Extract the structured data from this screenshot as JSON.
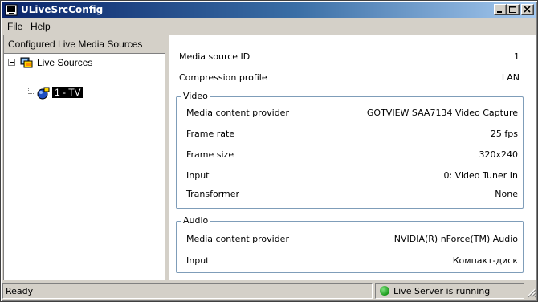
{
  "window": {
    "title": "ULiveSrcConfig"
  },
  "menu": {
    "items": [
      "File",
      "Help"
    ]
  },
  "left_pane": {
    "header": "Configured Live Media Sources",
    "tree": {
      "root_label": "Live Sources",
      "child_label": "1 - TV"
    }
  },
  "properties": {
    "top": [
      {
        "label": "Media source ID",
        "value": "1"
      },
      {
        "label": "Compression profile",
        "value": "LAN"
      }
    ],
    "video": {
      "title": "Video",
      "rows": [
        {
          "label": "Media content provider",
          "value": "GOTVIEW SAA7134 Video Capture"
        },
        {
          "label": "Frame rate",
          "value": "25 fps"
        },
        {
          "label": "Frame size",
          "value": "320x240"
        },
        {
          "label": "Input",
          "value": "0: Video Tuner In"
        },
        {
          "label": "Transformer",
          "value": "None"
        }
      ]
    },
    "audio": {
      "title": "Audio",
      "rows": [
        {
          "label": "Media content provider",
          "value": "NVIDIA(R) nForce(TM) Audio"
        },
        {
          "label": "Input",
          "value": "Компакт-диск"
        }
      ]
    }
  },
  "status": {
    "left": "Ready",
    "server": "Live Server is running",
    "server_color": "#1a9a1a"
  }
}
